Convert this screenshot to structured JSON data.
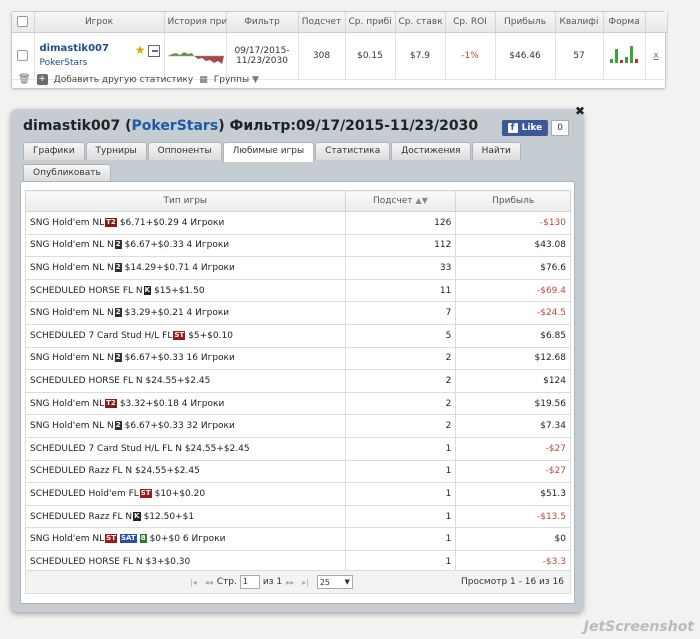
{
  "top": {
    "headers": {
      "player": "Игрок",
      "history": "История при",
      "filter": "Фильтр",
      "count": "Подсчет",
      "avg_profit": "Ср. прибі",
      "avg_stake": "Ср. ставк",
      "avg_roi": "Ср. ROI",
      "profit": "Прибыль",
      "qual": "Квалифі",
      "form": "Форма"
    },
    "row": {
      "player_name": "dimastik007",
      "player_site": "PokerStars",
      "filter_line1": "09/17/2015-",
      "filter_line2": "11/23/2030",
      "count": "308",
      "avg_profit": "$0.15",
      "avg_stake": "$7.9",
      "avg_roi": "-1%",
      "profit": "$46.46",
      "qual": "57",
      "remove_label": "x"
    },
    "toolbar": {
      "add_label": "Добавить другую статистику",
      "groups_label": "Группы"
    }
  },
  "popup": {
    "title_prefix": "dimastik007 (",
    "title_site": "PokerStars",
    "title_suffix": ") Фильтр:09/17/2015-11/23/2030",
    "like_label": "Like",
    "like_count": "0",
    "tabs": [
      {
        "label": "Графики"
      },
      {
        "label": "Турниры"
      },
      {
        "label": "Оппоненты"
      },
      {
        "label": "Любимые игры",
        "active": true
      },
      {
        "label": "Статистика"
      },
      {
        "label": "Достижения"
      },
      {
        "label": "Найти"
      },
      {
        "label": "Опубликовать"
      }
    ],
    "table": {
      "col_game": "Тип игры",
      "col_count": "Подсчет",
      "col_profit": "Прибыль",
      "rows": [
        {
          "pre": "SNG Hold'em NL",
          "badges": [
            {
              "t": "T2",
              "c": "#8b1a1a"
            }
          ],
          "post": "$6.71+$0.29 4 Игроки",
          "count": "126",
          "profit": "-$130",
          "neg": true
        },
        {
          "pre": "SNG Hold'em NL N",
          "badges": [
            {
              "t": "2",
              "c": "#333333"
            }
          ],
          "post": "$6.67+$0.33 4 Игроки",
          "count": "112",
          "profit": "$43.08",
          "neg": false
        },
        {
          "pre": "SNG Hold'em NL N",
          "badges": [
            {
              "t": "2",
              "c": "#333333"
            }
          ],
          "post": "$14.29+$0.71 4 Игроки",
          "count": "33",
          "profit": "$76.6",
          "neg": false
        },
        {
          "pre": "SCHEDULED HORSE FL N",
          "badges": [
            {
              "t": "K",
              "c": "#222222"
            }
          ],
          "post": "$15+$1.50",
          "count": "11",
          "profit": "-$69.4",
          "neg": true
        },
        {
          "pre": "SNG Hold'em NL N",
          "badges": [
            {
              "t": "2",
              "c": "#333333"
            }
          ],
          "post": "$3.29+$0.21 4 Игроки",
          "count": "7",
          "profit": "-$24.5",
          "neg": true
        },
        {
          "pre": "SCHEDULED 7 Card Stud H/L FL",
          "badges": [
            {
              "t": "ST",
              "c": "#a01818"
            }
          ],
          "post": "$5+$0.10",
          "count": "5",
          "profit": "$6.85",
          "neg": false
        },
        {
          "pre": "SNG Hold'em NL N",
          "badges": [
            {
              "t": "2",
              "c": "#333333"
            }
          ],
          "post": "$6.67+$0.33 16 Игроки",
          "count": "2",
          "profit": "$12.68",
          "neg": false
        },
        {
          "pre": "SCHEDULED HORSE FL N",
          "badges": [],
          "post": "$24.55+$2.45",
          "count": "2",
          "profit": "$124",
          "neg": false
        },
        {
          "pre": "SNG Hold'em NL",
          "badges": [
            {
              "t": "T2",
              "c": "#8b1a1a"
            }
          ],
          "post": "$3.32+$0.18 4 Игроки",
          "count": "2",
          "profit": "$19.56",
          "neg": false
        },
        {
          "pre": "SNG Hold'em NL N",
          "badges": [
            {
              "t": "2",
              "c": "#333333"
            }
          ],
          "post": "$6.67+$0.33 32 Игроки",
          "count": "2",
          "profit": "$7.34",
          "neg": false
        },
        {
          "pre": "SCHEDULED 7 Card Stud H/L FL N",
          "badges": [],
          "post": "$24.55+$2.45",
          "count": "1",
          "profit": "-$27",
          "neg": true
        },
        {
          "pre": "SCHEDULED Razz FL N",
          "badges": [],
          "post": "$24.55+$2.45",
          "count": "1",
          "profit": "-$27",
          "neg": true
        },
        {
          "pre": "SCHEDULED Hold'em FL",
          "badges": [
            {
              "t": "ST",
              "c": "#a01818"
            }
          ],
          "post": "$10+$0.20",
          "count": "1",
          "profit": "$51.3",
          "neg": false
        },
        {
          "pre": "SCHEDULED Razz FL N",
          "badges": [
            {
              "t": "K",
              "c": "#222222"
            }
          ],
          "post": "$12.50+$1",
          "count": "1",
          "profit": "-$13.5",
          "neg": true
        },
        {
          "pre": "SNG Hold'em NL",
          "badges": [
            {
              "t": "ST",
              "c": "#a01818"
            },
            {
              "t": "SAT",
              "c": "#2b4fa8"
            },
            {
              "t": "8",
              "c": "#2f7a2f"
            }
          ],
          "post": "$0+$0 6 Игроки",
          "count": "1",
          "profit": "$0",
          "neg": false
        },
        {
          "pre": "SCHEDULED HORSE FL N",
          "badges": [],
          "post": "$3+$0.30",
          "count": "1",
          "profit": "-$3.3",
          "neg": true
        }
      ]
    },
    "pager": {
      "page_label": "Стр.",
      "page_value": "1",
      "of_label": "из 1",
      "per_page": "25",
      "info": "Просмотр 1 - 16 из 16"
    }
  },
  "watermark": "JetScreenshot",
  "colors": {
    "negative": "#b54a3c",
    "link": "#1c4f8c",
    "sparkline_pos": "#5a9a4a",
    "sparkline_neg": "#a84a4a",
    "form_green": "#3aa33a",
    "form_red": "#c03030"
  }
}
